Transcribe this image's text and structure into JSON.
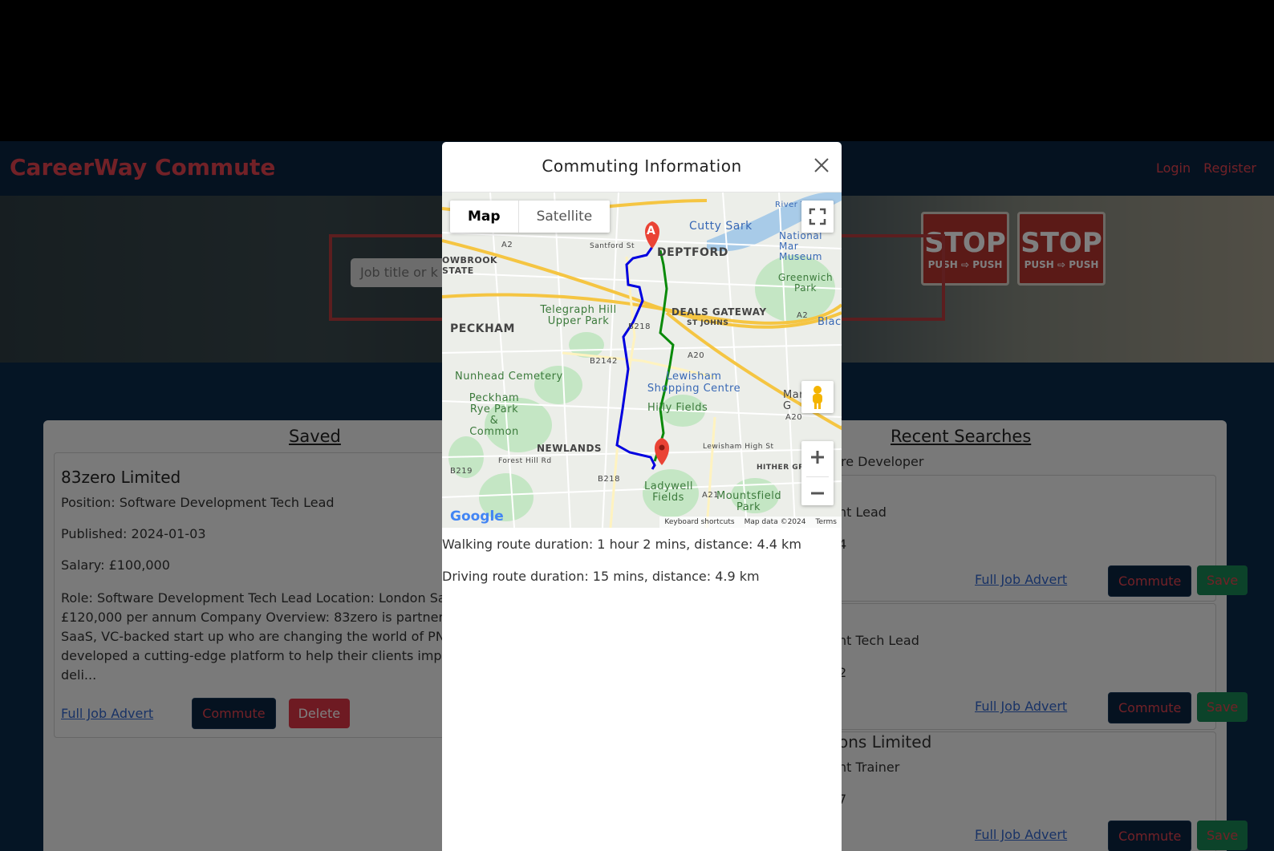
{
  "app": {
    "brand": "CareerWay Commute",
    "nav": {
      "login": "Login",
      "register": "Register"
    }
  },
  "hero": {
    "search_placeholder": "Job title or k",
    "stop_sign_text": "STOP",
    "stop_sign_subtext": "PUSH ⇨ PUSH"
  },
  "saved": {
    "title": "Saved",
    "card": {
      "company": "83zero Limited",
      "position": "Position: Software Development Tech Lead",
      "published": "Published: 2024-01-03",
      "salary": "Salary: £100,000",
      "description": "Role: Software Development Tech Lead Location: London Sa £120,000 per annum Company Overview: 83zero is partnere SaaS, VC-backed start up who are changing the world of PN developed a cutting-edge platform to help their clients imp deli...",
      "link": "Full Job Advert",
      "commute": "Commute",
      "delete": "Delete"
    }
  },
  "recent": {
    "title": "Recent Searches",
    "search_term": "re Developer",
    "cards": [
      {
        "position": "nt Lead",
        "published": "4",
        "link": "Full Job Advert",
        "commute": "Commute",
        "save": "Save"
      },
      {
        "position": "nt Tech Lead",
        "published": "2",
        "link": "Full Job Advert",
        "commute": "Commute",
        "save": "Save"
      },
      {
        "company": "ons Limited",
        "position": "nt Trainer",
        "published": "7",
        "link": "Full Job Advert",
        "commute": "Commute",
        "save": "Save"
      }
    ]
  },
  "modal": {
    "title": "Commuting Information",
    "map": {
      "tab_map": "Map",
      "tab_satellite": "Satellite",
      "marker_a": "A",
      "labels": {
        "deptford": "DEPTFORD",
        "cutty_sark": "Cutty Sark",
        "national_museum": "National Mar Museum",
        "greenwich_park": "Greenwich Park",
        "brookstate": "OWBROOK STATE",
        "peckham": "PECKHAM",
        "telegraph_hill": "Telegraph Hill Upper Park",
        "deals_gateway": "DEALS GATEWAY",
        "st_johns": "ST JOHNS",
        "blackheath": "Black",
        "nunhead": "Nunhead Cemetery",
        "lewisham": "Lewisham Shopping Centre",
        "peckham_rye": "Peckham Rye Park & Common",
        "hilly_fields": "Hilly Fields",
        "newlands": "NEWLANDS",
        "ladywell": "Ladywell Fields",
        "mountsfield": "Mountsfield Park",
        "hither_green": "HITHER GRE",
        "a2": "A2",
        "a20": "A20",
        "b218": "B218",
        "b2142": "B2142",
        "b219": "B219",
        "a21": "A21",
        "river": "River T",
        "forest_hill": "Forest Hill Rd",
        "santford": "Santford St",
        "lewisham_high": "Lewisham High St",
        "mar_g": "Mar us G"
      },
      "footer": {
        "shortcuts": "Keyboard shortcuts",
        "data": "Map data ©2024",
        "terms": "Terms"
      },
      "logo": "Google"
    },
    "walking": "Walking route duration: 1 hour 2 mins, distance: 4.4 km",
    "driving": "Driving route duration: 15 mins, distance: 4.9 km"
  },
  "colors": {
    "brand_red": "#e4434f",
    "navy": "#0a2540",
    "walking_route": "#0000e0",
    "driving_route": "#0a8a0a",
    "marker": "#ea4335"
  }
}
